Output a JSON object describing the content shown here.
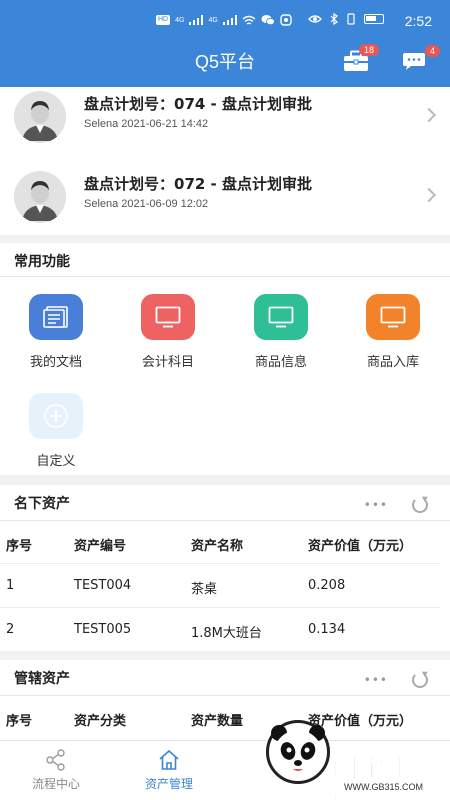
{
  "status_bar": {
    "time": "2:52",
    "network_badge": "HD",
    "signal_label_1": "4G",
    "signal_label_2": "4G"
  },
  "header": {
    "title": "Q5平台",
    "toolbox_badge": "18",
    "message_badge": "4"
  },
  "approvals": [
    {
      "title": "盘点计划号：074 - 盘点计划审批",
      "meta": "Selena 2021-06-21 14:42"
    },
    {
      "title": "盘点计划号：072 - 盘点计划审批",
      "meta": "Selena 2021-06-09 12:02"
    }
  ],
  "common_functions": {
    "title": "常用功能",
    "items": [
      {
        "label": "我的文档",
        "icon": "document-icon",
        "color": "#4a7fd9"
      },
      {
        "label": "会计科目",
        "icon": "monitor-icon",
        "color": "#ee6262"
      },
      {
        "label": "商品信息",
        "icon": "monitor-icon",
        "color": "#2ebf96"
      },
      {
        "label": "商品入库",
        "icon": "monitor-icon",
        "color": "#f3832a"
      },
      {
        "label": "自定义",
        "icon": "add-icon",
        "color": "#e6f1fc"
      }
    ]
  },
  "owned_assets": {
    "title": "名下资产",
    "columns": [
      "序号",
      "资产编号",
      "资产名称",
      "资产价值（万元）"
    ],
    "rows": [
      [
        "1",
        "TEST004",
        "茶桌",
        "0.208"
      ],
      [
        "2",
        "TEST005",
        "1.8M大班台",
        "0.134"
      ]
    ]
  },
  "managed_assets": {
    "title": "管辖资产",
    "columns": [
      "序号",
      "资产分类",
      "资产数量",
      "资产价值（万元）"
    ]
  },
  "bottom_nav": [
    {
      "label": "流程中心",
      "icon": "share-icon",
      "active": false
    },
    {
      "label": "资产管理",
      "icon": "home-icon",
      "active": true
    }
  ],
  "watermark": {
    "text": "国宝手游网",
    "url": "WWW.GB315.COM"
  },
  "colors": {
    "primary": "#3b86d8",
    "badge": "#ea5753",
    "watermark_green": "#13a54a"
  }
}
